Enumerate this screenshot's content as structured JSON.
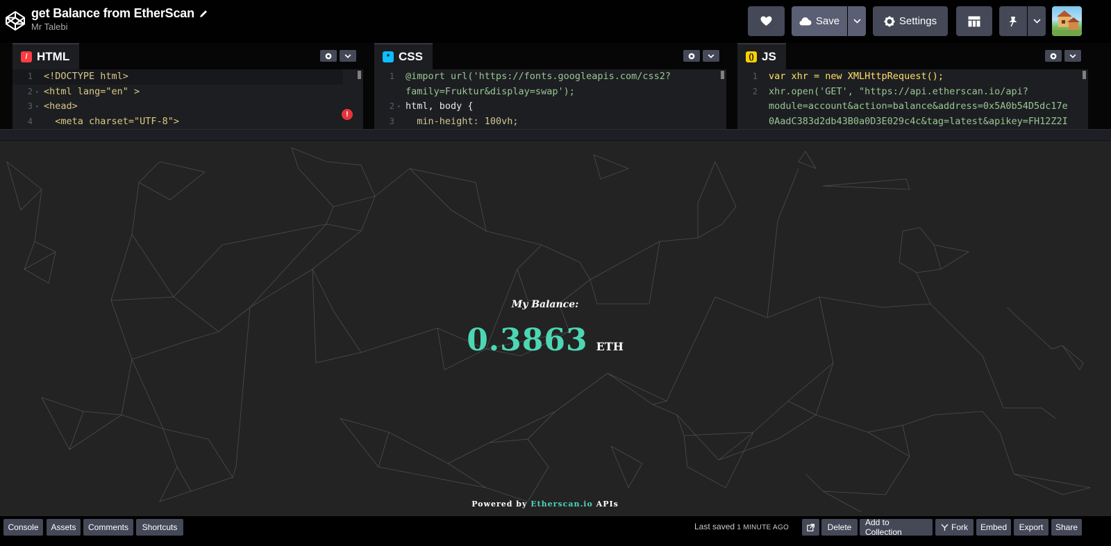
{
  "header": {
    "title": "get Balance from EtherScan",
    "author": "Mr Talebi",
    "save_label": "Save",
    "settings_label": "Settings"
  },
  "editors": {
    "html": {
      "label": "HTML",
      "color": "#ff3c41",
      "lines": [
        {
          "n": "1",
          "fold": "",
          "text": "<!DOCTYPE html>"
        },
        {
          "n": "2",
          "fold": "▾",
          "text": "<html lang=\"en\" >"
        },
        {
          "n": "3",
          "fold": "▾",
          "text": "<head>"
        },
        {
          "n": "4",
          "fold": "",
          "text": "  <meta charset=\"UTF-8\">"
        }
      ]
    },
    "css": {
      "label": "CSS",
      "color": "#0ebeff",
      "lines": [
        {
          "n": "1",
          "fold": "",
          "text": "@import url('https://fonts.googleapis.com/css2?"
        },
        {
          "n": "",
          "fold": "",
          "text": "family=Fruktur&display=swap');"
        },
        {
          "n": "2",
          "fold": "▾",
          "text": "html, body {"
        },
        {
          "n": "3",
          "fold": "",
          "text": "  min-height: 100vh;"
        }
      ]
    },
    "js": {
      "label": "JS",
      "color": "#fcd000",
      "lines": [
        {
          "n": "1",
          "fold": "",
          "text": "var xhr = new XMLHttpRequest();"
        },
        {
          "n": "2",
          "fold": "",
          "text": "xhr.open('GET', \"https://api.etherscan.io/api?"
        },
        {
          "n": "",
          "fold": "",
          "text": "module=account&action=balance&address=0x5A0b54D5dc17e"
        },
        {
          "n": "",
          "fold": "",
          "text": "0AadC383d2db43B0a0D3E029c4c&tag=latest&apikey=FH12Z2I"
        }
      ]
    }
  },
  "preview": {
    "balance_label": "My Balance:",
    "balance_value": "0.3863",
    "balance_unit": "ETH",
    "powered_prefix": "Powered by ",
    "powered_link": "Etherscan.io",
    "powered_suffix": " APIs",
    "accent": "#4dd6b3",
    "background": "#232323"
  },
  "footer": {
    "console": "Console",
    "assets": "Assets",
    "comments": "Comments",
    "shortcuts": "Shortcuts",
    "last_saved": "Last saved",
    "last_saved_ago": "1 MINUTE AGO",
    "delete": "Delete",
    "add_to_collection": "Add to Collection",
    "fork": "Fork",
    "embed": "Embed",
    "export": "Export",
    "share": "Share"
  }
}
